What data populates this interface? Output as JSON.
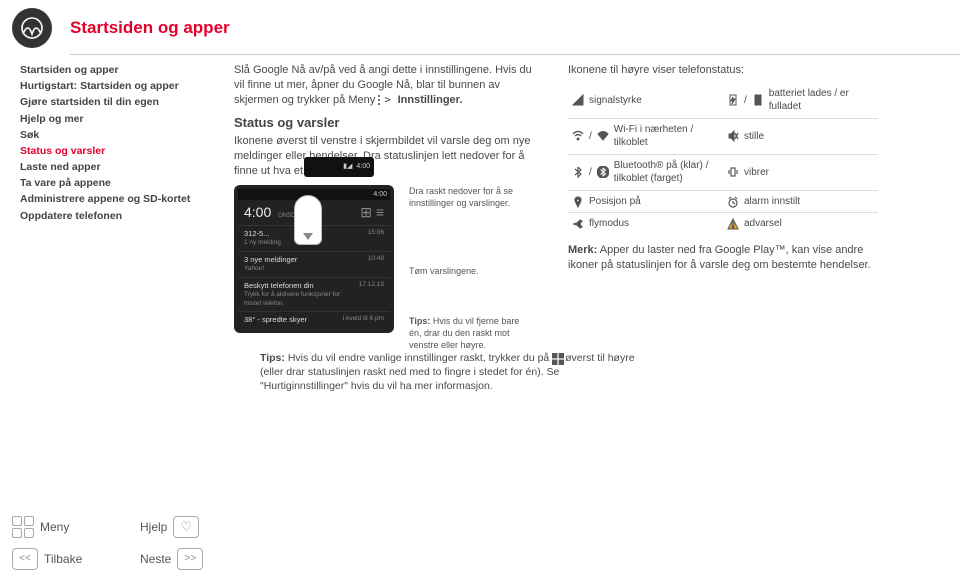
{
  "header": {
    "title": "Startsiden og apper"
  },
  "sidebar": {
    "items": [
      {
        "label": "Startsiden og apper"
      },
      {
        "label": "Hurtigstart: Startsiden og apper"
      },
      {
        "label": "Gjøre startsiden til din egen"
      },
      {
        "label": "Hjelp og mer"
      },
      {
        "label": "Søk"
      },
      {
        "label": "Status og varsler"
      },
      {
        "label": "Laste ned apper"
      },
      {
        "label": "Ta vare på appene"
      },
      {
        "label": "Administrere appene og SD-kortet"
      },
      {
        "label": "Oppdatere telefonen"
      }
    ],
    "active_index": 5
  },
  "col1": {
    "intro": "Slå Google Nå av/på ved å angi dette i innstillingene. Hvis du vil finne ut mer, åpner du Google Nå, blar til bunnen av skjermen og trykker på Meny ",
    "intro_tail": " Innstillinger.",
    "section_title": "Status og varsler",
    "section_body": "Ikonene øverst til venstre i skjermbildet vil varsle deg om nye meldinger eller hendelser. Dra statuslinjen lett nedover for å finne ut hva et ikon betyr.",
    "callout1": "Dra raskt nedover for å se innstillinger og varslinger.",
    "callout2": "Tøm varslingene.",
    "callout3_lead": "Tips:",
    "callout3": " Hvis du vil fjerne bare én, drar du den raskt mot venstre eller høyre.",
    "phone": {
      "status_time": "4:00",
      "clock": "4:00",
      "clock_sub": "ONSDAG",
      "rows": [
        {
          "title": "312-5...",
          "sub": "1 ny melding",
          "time": "15:06"
        },
        {
          "title": "3 nye meldinger",
          "sub": "Yahoo!",
          "time": "10:49"
        },
        {
          "title": "Beskytt telefonen din",
          "sub": "Trykk for å aktivere funksjoner for mistet telefon.",
          "time": "17.12.13"
        },
        {
          "title": "38° - spredte skyer",
          "sub": "",
          "time": "I kveld til 6 pm"
        }
      ]
    }
  },
  "col2": {
    "intro": "Ikonene til høyre viser telefonstatus:",
    "rows": [
      {
        "left": "signalstyrke",
        "right": "batteriet lades / er fulladet"
      },
      {
        "left": "Wi-Fi i nærheten / tilkoblet",
        "right": "stille"
      },
      {
        "left": "Bluetooth® på (klar) / tilkoblet (farget)",
        "right": "vibrer"
      },
      {
        "left": "Posisjon på",
        "right": "alarm innstilt"
      },
      {
        "left": "flymodus",
        "right": "advarsel"
      }
    ],
    "note_lead": "Merk:",
    "note": " Apper du laster ned fra Google Play™, kan vise andre ikoner på statuslinjen for å varsle deg om bestemte hendelser."
  },
  "tips": {
    "lead": "Tips:",
    "body": " Hvis du vil endre vanlige innstillinger raskt, trykker du på ",
    "body2": " øverst til høyre (eller drar statuslinjen raskt ned med to fingre i stedet for én). Se \"Hurtiginnstillinger\" hvis du vil ha mer informasjon."
  },
  "footer": {
    "menu": "Meny",
    "help": "Hjelp",
    "back": "Tilbake",
    "next": "Neste"
  }
}
